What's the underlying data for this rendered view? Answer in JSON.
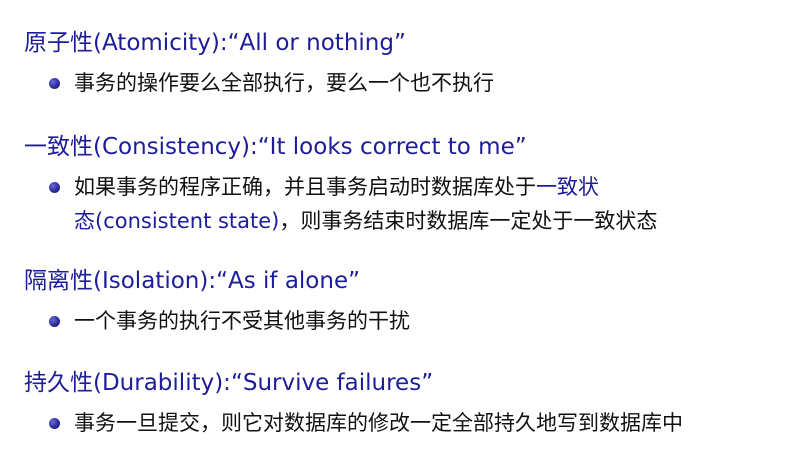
{
  "sections": [
    {
      "title": "原子性(Atomicity):",
      "tagline": "“All or nothing”",
      "bullet": "事务的操作要么全部执行，要么一个也不执行"
    },
    {
      "title": "一致性(Consistency):",
      "tagline": "“It looks correct to me”",
      "bullet_line1_pre": "如果事务的程序正确，并且事务启动时数据库处于",
      "bullet_line1_hl": "一致状",
      "bullet_line2_hl": "态(consistent state)",
      "bullet_line2_post": "，则事务结束时数据库一定处于一致状态"
    },
    {
      "title": "隔离性(Isolation):",
      "tagline": "“As if alone”",
      "bullet": "一个事务的执行不受其他事务的干扰"
    },
    {
      "title": "持久性(Durability):",
      "tagline": "“Survive failures”",
      "bullet": "事务一旦提交，则它对数据库的修改一定全部持久地写到数据库中"
    }
  ]
}
